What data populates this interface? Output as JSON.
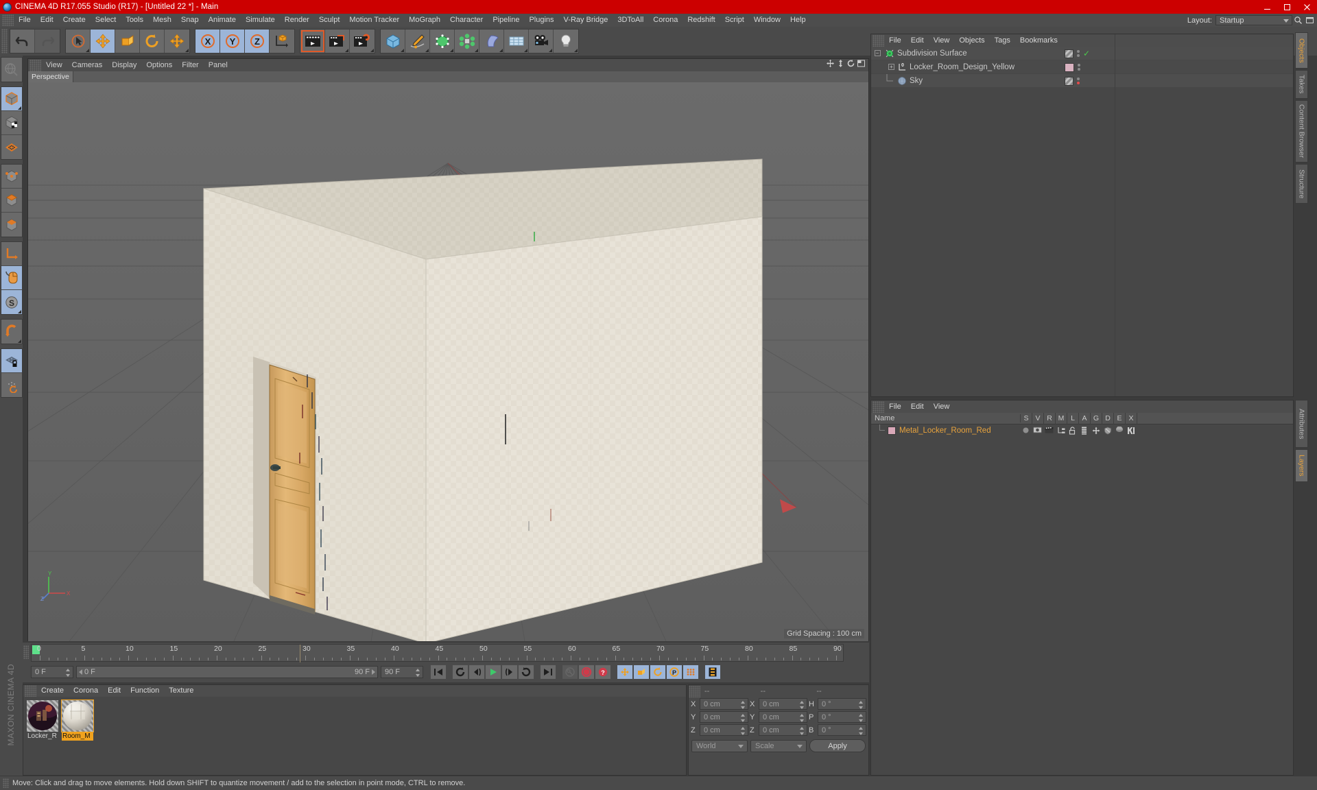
{
  "window": {
    "title": "CINEMA 4D R17.055 Studio (R17) - [Untitled 22 *] - Main",
    "app_icon": "c4d-logo-icon",
    "minimize": "minimize-icon",
    "maximize": "maximize-icon",
    "close": "close-icon",
    "titlebar_color": "#cc0000"
  },
  "menubar": {
    "items": [
      "File",
      "Edit",
      "Create",
      "Select",
      "Tools",
      "Mesh",
      "Snap",
      "Animate",
      "Simulate",
      "Render",
      "Sculpt",
      "Motion Tracker",
      "MoGraph",
      "Character",
      "Pipeline",
      "Plugins",
      "V-Ray Bridge",
      "3DToAll",
      "Corona",
      "Redshift",
      "Script",
      "Window",
      "Help"
    ],
    "layout_label": "Layout:",
    "layout_value": "Startup",
    "search_icon": "search-icon",
    "panel_icon": "panel-icon"
  },
  "toolbar": {
    "groups": [
      {
        "name": "history",
        "buttons": [
          {
            "name": "undo-button",
            "icon": "undo-icon",
            "state": "normal"
          },
          {
            "name": "redo-button",
            "icon": "redo-icon",
            "state": "disabled"
          }
        ]
      },
      {
        "name": "tools",
        "buttons": [
          {
            "name": "live-selection-button",
            "icon": "live-selection-icon",
            "state": "normal"
          },
          {
            "name": "move-tool-button",
            "icon": "move-icon",
            "state": "active"
          },
          {
            "name": "scale-tool-button",
            "icon": "scale-icon",
            "state": "normal"
          },
          {
            "name": "rotate-tool-button",
            "icon": "rotate-icon",
            "state": "normal"
          },
          {
            "name": "move-alt-button",
            "icon": "move-icon",
            "state": "normal"
          }
        ]
      },
      {
        "name": "axis-locks",
        "buttons": [
          {
            "name": "lock-x-button",
            "icon": "x-axis-icon",
            "state": "active"
          },
          {
            "name": "lock-y-button",
            "icon": "y-axis-icon",
            "state": "active"
          },
          {
            "name": "lock-z-button",
            "icon": "z-axis-icon",
            "state": "active"
          },
          {
            "name": "world-object-coordinate-button",
            "icon": "world-axis-icon",
            "state": "normal"
          }
        ]
      },
      {
        "name": "render",
        "buttons": [
          {
            "name": "render-view-button",
            "icon": "render-view-icon",
            "state": "selected"
          },
          {
            "name": "render-region-button",
            "icon": "render-region-icon",
            "state": "normal"
          },
          {
            "name": "render-settings-button",
            "icon": "render-settings-icon",
            "state": "normal"
          }
        ]
      },
      {
        "name": "create",
        "buttons": [
          {
            "name": "add-cube-button",
            "icon": "cube-icon",
            "state": "normal"
          },
          {
            "name": "add-spline-button",
            "icon": "pen-spline-icon",
            "state": "normal"
          },
          {
            "name": "add-generator-button",
            "icon": "generator-icon",
            "state": "normal"
          },
          {
            "name": "add-mograph-button",
            "icon": "mograph-icon",
            "state": "normal"
          },
          {
            "name": "add-deformer-button",
            "icon": "deformer-icon",
            "state": "normal"
          },
          {
            "name": "add-environment-button",
            "icon": "floor-environment-icon",
            "state": "normal"
          },
          {
            "name": "add-camera-button",
            "icon": "camera-icon",
            "state": "normal"
          },
          {
            "name": "add-light-button",
            "icon": "light-bulb-icon",
            "state": "normal"
          }
        ]
      }
    ]
  },
  "left_toolbar": {
    "buttons": [
      {
        "name": "make-editable-button",
        "icon": "make-editable-icon",
        "state": "disabled"
      },
      {
        "name": "model-mode-button",
        "icon": "model-mode-icon",
        "state": "active"
      },
      {
        "name": "texture-mode-button",
        "icon": "texture-mode-icon",
        "state": "normal"
      },
      {
        "name": "points-mode-button",
        "icon": "points-mode-icon",
        "state": "normal"
      },
      {
        "name": "point-mode-button",
        "icon": "point-mode-icon",
        "state": "normal"
      },
      {
        "name": "edge-mode-button",
        "icon": "edge-mode-icon",
        "state": "normal"
      },
      {
        "name": "polygon-mode-button",
        "icon": "polygon-mode-icon",
        "state": "normal"
      },
      {
        "name": "object-axis-button",
        "icon": "object-axis-icon",
        "state": "normal"
      },
      {
        "name": "viewport-solo-button",
        "icon": "mouse-icon",
        "state": "active"
      },
      {
        "name": "scale-snap-button",
        "icon": "s-circle-icon",
        "state": "active"
      },
      {
        "name": "magnet-button",
        "icon": "magnet-icon",
        "state": "normal"
      },
      {
        "name": "lock-workplane-button",
        "icon": "workplane-lock-icon",
        "state": "active"
      },
      {
        "name": "workplane-rotate-button",
        "icon": "workplane-rotate-icon",
        "state": "normal"
      }
    ],
    "brand": "MAXON CINEMA 4D"
  },
  "viewport": {
    "menu": [
      "View",
      "Cameras",
      "Display",
      "Options",
      "Filter",
      "Panel"
    ],
    "tab": "Perspective",
    "grid_spacing": "Grid Spacing : 100 cm",
    "axis_labels": {
      "y": "Y",
      "x": "X",
      "z": "Z"
    },
    "right_icons": [
      "pan-viewport-icon",
      "dolly-viewport-icon",
      "rotate-viewport-icon",
      "maximize-viewport-icon"
    ],
    "scene": {
      "description": "Locker room interior box with wooden door",
      "wall_color": "#e3ded2",
      "floor_color": "#6e6e6e",
      "door_color": "#d8a866"
    }
  },
  "timeline": {
    "ticks": [
      "0",
      "5",
      "10",
      "15",
      "20",
      "25",
      "30",
      "35",
      "40",
      "45",
      "50",
      "55",
      "60",
      "65",
      "70",
      "75",
      "80",
      "85",
      "90"
    ],
    "current_frame": "0 F",
    "range_start": "0 F",
    "range_end": "90 F",
    "end_frame": "90 F",
    "playhead_frame": "0 F",
    "transport": [
      {
        "name": "go-to-start-button",
        "icon": "skip-start-icon"
      },
      {
        "name": "play-backwards-button",
        "icon": "rewind-loop-icon"
      },
      {
        "name": "previous-frame-button",
        "icon": "step-back-icon"
      },
      {
        "name": "play-button",
        "icon": "play-icon"
      },
      {
        "name": "next-frame-button",
        "icon": "step-forward-icon"
      },
      {
        "name": "play-forwards-button",
        "icon": "forward-loop-icon"
      },
      {
        "name": "go-to-end-button",
        "icon": "skip-end-icon"
      }
    ],
    "record_group": [
      {
        "name": "autokey-button",
        "icon": "key-icon",
        "state": "disabled"
      },
      {
        "name": "record-active-objects-button",
        "icon": "record-icon",
        "state": "normal"
      },
      {
        "name": "autokeying-button",
        "icon": "question-record-icon",
        "state": "normal"
      }
    ],
    "key_toggles": [
      {
        "name": "key-position-button",
        "icon": "move-icon",
        "state": "active"
      },
      {
        "name": "key-scale-button",
        "icon": "scale-icon",
        "state": "active"
      },
      {
        "name": "key-rotation-button",
        "icon": "rotate-icon",
        "state": "active"
      },
      {
        "name": "key-parameter-button",
        "icon": "p-circle-icon",
        "state": "active"
      },
      {
        "name": "key-pointlevel-button",
        "icon": "point-grid-icon",
        "state": "active"
      }
    ],
    "timeline_view_button": {
      "name": "timeline-view-button",
      "icon": "film-strip-icon",
      "state": "active"
    }
  },
  "material_manager": {
    "menu": [
      "Create",
      "Corona",
      "Edit",
      "Function",
      "Texture"
    ],
    "materials": [
      {
        "name": "Locker_R",
        "full_name": "Locker_Room",
        "selected": false,
        "swatch": "locker-material-preview"
      },
      {
        "name": "Room_M",
        "full_name": "Room_Metal",
        "selected": true,
        "swatch": "room-metal-material-preview"
      }
    ]
  },
  "coordinate_manager": {
    "header": [
      "--",
      "--",
      "--"
    ],
    "position": {
      "label_x": "X",
      "label_y": "Y",
      "label_z": "Z",
      "x": "0 cm",
      "y": "0 cm",
      "z": "0 cm"
    },
    "size": {
      "label_x": "X",
      "label_y": "Y",
      "label_z": "Z",
      "x": "0 cm",
      "y": "0 cm",
      "z": "0 cm"
    },
    "rotation": {
      "label_h": "H",
      "label_p": "P",
      "label_b": "B",
      "h": "0 °",
      "p": "0 °",
      "b": "0 °"
    },
    "coord_system": "World",
    "size_mode": "Scale",
    "apply_label": "Apply"
  },
  "object_manager": {
    "menu": [
      "File",
      "Edit",
      "View",
      "Objects",
      "Tags",
      "Bookmarks"
    ],
    "objects": [
      {
        "name": "Subdivision Surface",
        "icon": "subdivision-surface-icon",
        "indent": 0,
        "expander": "-",
        "tags": [
          "texture-tag",
          "dots",
          "green-check"
        ],
        "color_chip": null
      },
      {
        "name": "Locker_Room_Design_Yellow",
        "icon": "null-object-icon",
        "indent": 1,
        "expander": "+",
        "tags": [
          "color-chip",
          "dots"
        ],
        "color_chip": "#d9b2c0"
      },
      {
        "name": "Sky",
        "icon": "sky-object-icon",
        "indent": 1,
        "expander": "",
        "tags": [
          "texture-tag",
          "dots",
          "red-dot"
        ],
        "color_chip": null
      }
    ]
  },
  "tag_manager": {
    "menu": [
      "File",
      "Edit",
      "View"
    ],
    "columns": [
      "Name",
      "S",
      "V",
      "R",
      "M",
      "L",
      "A",
      "G",
      "D",
      "E",
      "X"
    ],
    "rows": [
      {
        "name": "Metal_Locker_Room_Red",
        "color": "#e8a33d",
        "chip": "#d9a8b8",
        "icons": [
          "sphere-icon",
          "display-icon",
          "clapper-icon",
          "hierarchy-icon",
          "unlock-icon",
          "layers-icon",
          "axis-icon",
          "shield-icon",
          "dome-icon",
          "mograph-icon"
        ]
      }
    ]
  },
  "right_tabs": {
    "top": [
      {
        "label": "Objects",
        "active": true
      },
      {
        "label": "Takes",
        "active": false
      },
      {
        "label": "Content Browser",
        "active": false
      },
      {
        "label": "Structure",
        "active": false
      }
    ],
    "bottom": [
      {
        "label": "Attributes",
        "active": false
      },
      {
        "label": "Layers",
        "active": true
      }
    ]
  },
  "statusbar": {
    "text": "Move: Click and drag to move elements. Hold down SHIFT to quantize movement / add to the selection in point mode, CTRL to remove."
  }
}
